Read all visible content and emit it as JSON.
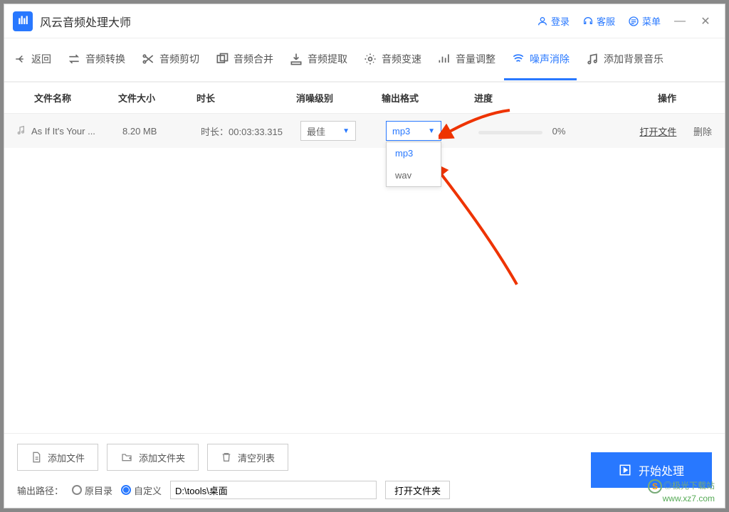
{
  "app": {
    "title": "风云音频处理大师"
  },
  "titleActions": {
    "login": "登录",
    "support": "客服",
    "menu": "菜单"
  },
  "toolbar": {
    "back": "返回",
    "convert": "音频转换",
    "cut": "音频剪切",
    "merge": "音频合并",
    "extract": "音频提取",
    "speed": "音频变速",
    "volume": "音量调整",
    "denoise": "噪声消除",
    "bgm": "添加背景音乐"
  },
  "columns": {
    "name": "文件名称",
    "size": "文件大小",
    "duration": "时长",
    "level": "消噪级别",
    "format": "输出格式",
    "progress": "进度",
    "action": "操作"
  },
  "row": {
    "name": "As If It's Your ...",
    "size": "8.20 MB",
    "durationPrefix": "时长：",
    "duration": "00:03:33.315",
    "level": "最佳",
    "format": "mp3",
    "progress": "0%",
    "open": "打开文件",
    "delete": "删除"
  },
  "dropdown": {
    "opt1": "mp3",
    "opt2": "wav"
  },
  "bottom": {
    "addFile": "添加文件",
    "addFolder": "添加文件夹",
    "clearList": "清空列表",
    "outputPath": "输出路径：",
    "original": "原目录",
    "custom": "自定义",
    "pathValue": "D:\\tools\\桌面",
    "openFolder": "打开文件夹",
    "start": "开始处理"
  },
  "watermark": {
    "line1": "◎极光下载站",
    "line2": "www.xz7.com"
  }
}
